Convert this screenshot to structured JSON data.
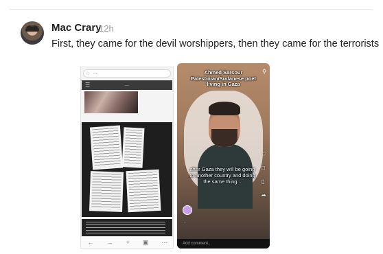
{
  "post": {
    "author": "Mac Crary",
    "time": "12h",
    "text": "First, they came for the devil worshippers, then they came for the terrorists"
  },
  "left_screenshot": {
    "url": "...",
    "site_name": "...",
    "icons": [
      "lock-icon",
      "menu-icon",
      "back-icon",
      "forward-icon",
      "add-icon",
      "tabs-icon",
      "more-icon"
    ]
  },
  "right_screenshot": {
    "title_line1": "Ahmed Sarsour",
    "title_line2": "Palestinian/Sudanese poet",
    "title_line3": "living in Gaza",
    "caption": "after Gaza they will be going to another country and doing the same thing...",
    "music": "...",
    "comment_placeholder": "Add comment...",
    "icons": [
      "search-icon",
      "heart-icon",
      "comment-icon",
      "bookmark-icon",
      "share-icon"
    ]
  }
}
